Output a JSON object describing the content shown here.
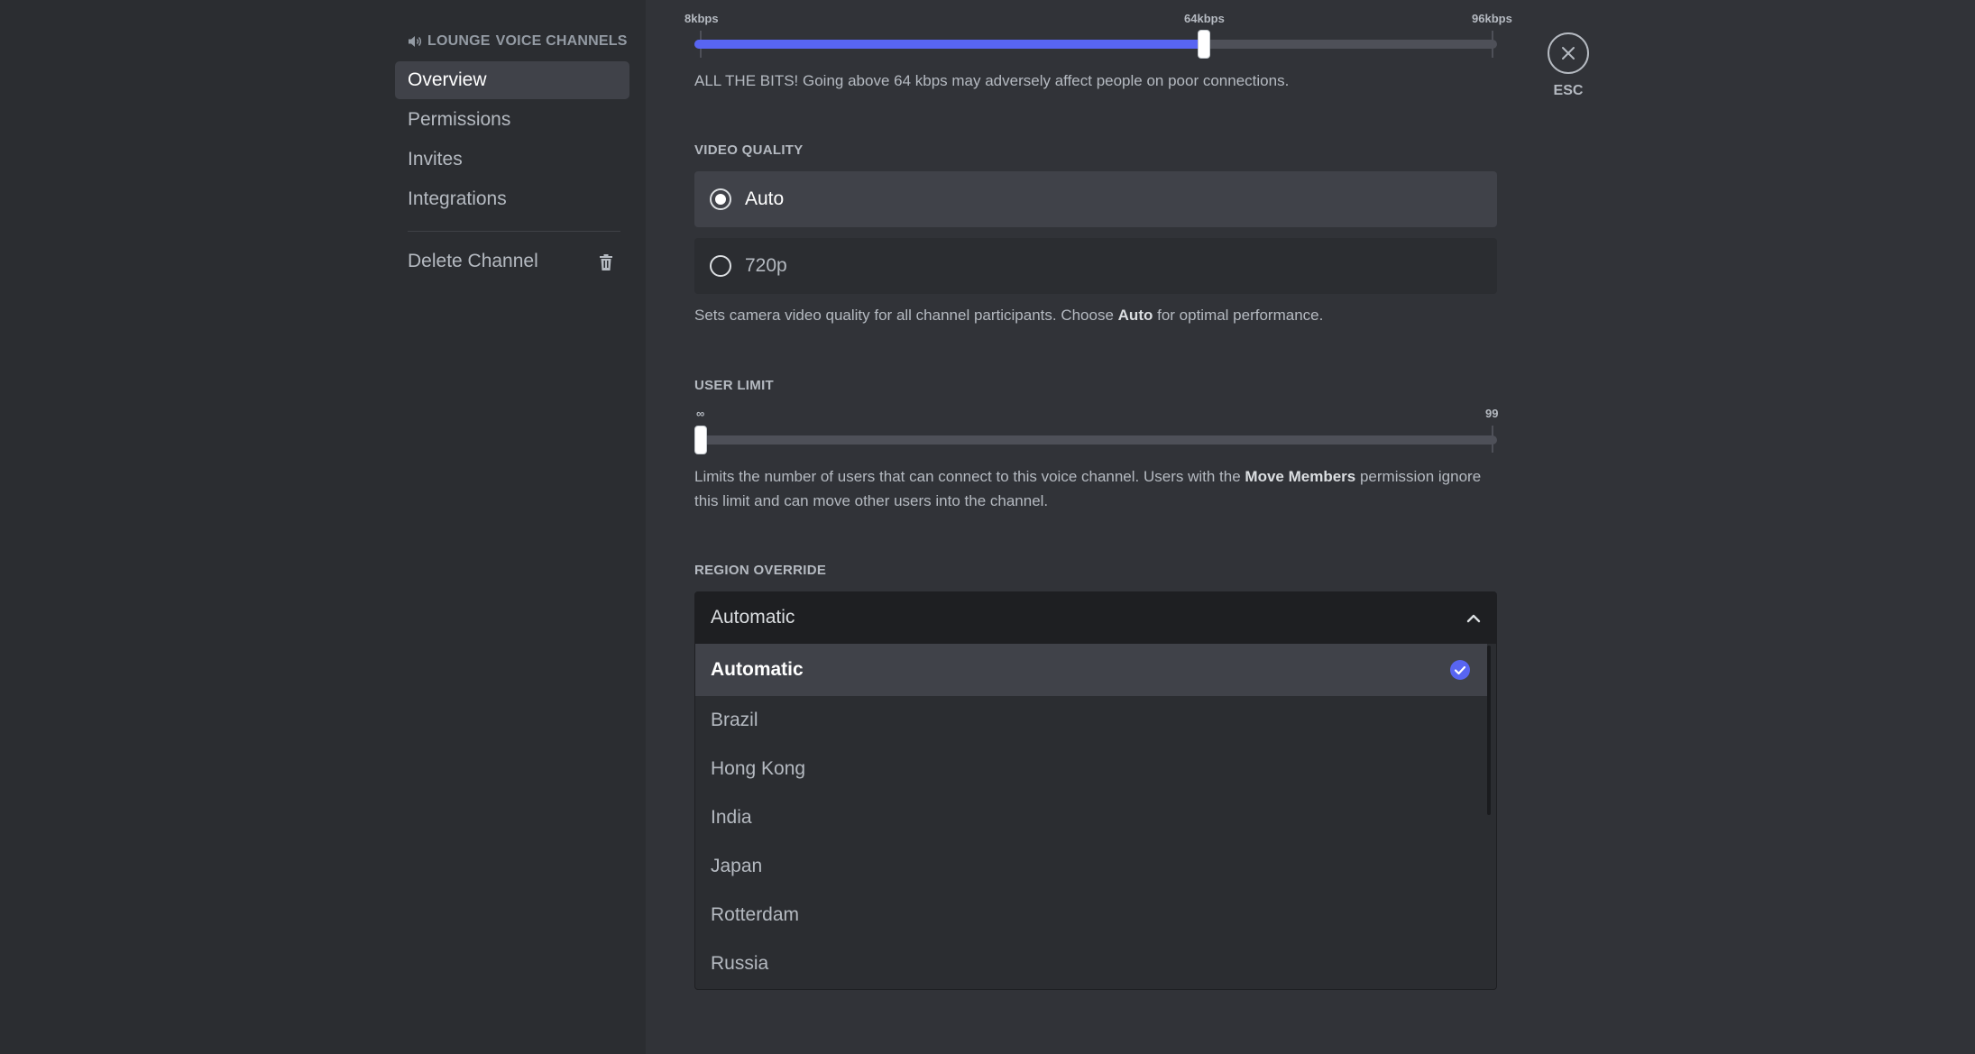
{
  "sidebar": {
    "header_prefix": "LOUNGE",
    "header_suffix": "VOICE CHANNELS",
    "items": [
      {
        "label": "Overview"
      },
      {
        "label": "Permissions"
      },
      {
        "label": "Invites"
      },
      {
        "label": "Integrations"
      }
    ],
    "delete_label": "Delete Channel"
  },
  "bitrate": {
    "ticks": [
      "8kbps",
      "64kbps",
      "96kbps"
    ],
    "min": 8,
    "max": 96,
    "value": 64,
    "help": "ALL THE BITS! Going above 64 kbps may adversely affect people on poor connections."
  },
  "video_quality": {
    "title": "VIDEO QUALITY",
    "options": [
      {
        "label": "Auto",
        "selected": true
      },
      {
        "label": "720p",
        "selected": false
      }
    ],
    "help_pre": "Sets camera video quality for all channel participants. Choose ",
    "help_bold": "Auto",
    "help_post": " for optimal performance."
  },
  "user_limit": {
    "title": "USER LIMIT",
    "ticks": [
      "∞",
      "99"
    ],
    "min": 0,
    "max": 99,
    "value": 0,
    "help_pre": "Limits the number of users that can connect to this voice channel. Users with the ",
    "help_bold": "Move Members",
    "help_post": " permission ignore this limit and can move other users into the channel."
  },
  "region_override": {
    "title": "REGION OVERRIDE",
    "selected": "Automatic",
    "options": [
      "Automatic",
      "Brazil",
      "Hong Kong",
      "India",
      "Japan",
      "Rotterdam",
      "Russia"
    ]
  },
  "esc_label": "ESC",
  "colors": {
    "accent": "#5865f2",
    "background": "#313338",
    "sidebar": "#2b2d31"
  }
}
